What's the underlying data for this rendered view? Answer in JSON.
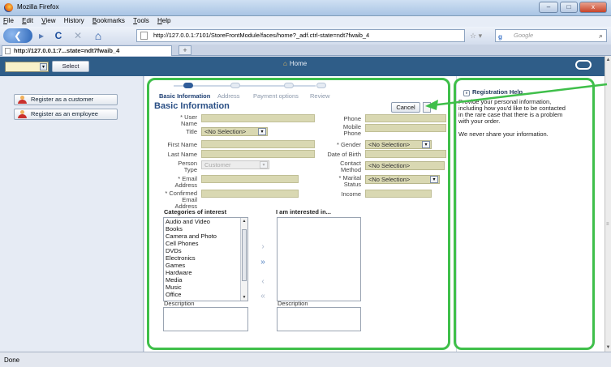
{
  "window": {
    "title": "Mozilla Firefox",
    "minimize_glyph": "–",
    "maximize_glyph": "□",
    "close_glyph": "x"
  },
  "menu": {
    "items": [
      {
        "label": "File",
        "key": "F",
        "rest": "ile"
      },
      {
        "label": "Edit",
        "key": "E",
        "rest": "dit"
      },
      {
        "label": "View",
        "key": "V",
        "rest": "iew"
      },
      {
        "label": "History",
        "key": "",
        "rest": "History"
      },
      {
        "label": "Bookmarks",
        "key": "B",
        "rest": "ookmarks"
      },
      {
        "label": "Tools",
        "key": "T",
        "rest": "ools"
      },
      {
        "label": "Help",
        "key": "H",
        "rest": "elp"
      }
    ]
  },
  "navbar": {
    "back_glyph": "❮",
    "forward_glyph": "▸",
    "reload_glyph": "C",
    "stop_glyph": "✕",
    "home_glyph": "⌂",
    "url": "http://127.0.0.1:7101/StoreFrontModule/faces/home?_adf.ctrl-state=ndt7fwaib_4",
    "star_glyph": "☆ ▾",
    "search_engine": "g",
    "search_placeholder": "Google",
    "search_glyph": "⌕"
  },
  "tabs": {
    "active_tab": "http://127.0.0.1:7...state=ndt7fwaib_4",
    "new_tab_glyph": "+"
  },
  "appbar": {
    "select_button": "Select",
    "home_label": "Home",
    "home_glyph": "⌂"
  },
  "left_panel": {
    "register_customer": "Register as a customer",
    "register_employee": "Register as an employee"
  },
  "train": {
    "steps": [
      "Basic Information",
      "Address",
      "Payment options",
      "Review"
    ],
    "active_index": 0
  },
  "form": {
    "title": "Basic Information",
    "cancel": "Cancel",
    "labels": {
      "user_name": [
        "* User",
        "Name"
      ],
      "title": "Title",
      "first_name": "First Name",
      "last_name": "Last Name",
      "person_type": [
        "Person",
        "Type"
      ],
      "email": [
        "* Email",
        "Address"
      ],
      "confirmed_email": [
        "* Confirmed",
        "Email",
        "Address"
      ],
      "phone": "Phone",
      "mobile_phone": [
        "Mobile",
        "Phone"
      ],
      "gender": "* Gender",
      "date_of_birth": "Date of Birth",
      "contact_method": [
        "Contact",
        "Method"
      ],
      "marital_status": [
        "* Marital",
        "Status"
      ],
      "income": "Income"
    },
    "values": {
      "title": "<No Selection>",
      "person_type": "Customer",
      "gender": "<No Selection>",
      "contact_method": "<No Selection>",
      "marital_status": "<No Selection>"
    },
    "dropdown_glyph": "▾",
    "categories_header": "Categories of interest",
    "interested_header": "I am interested in...",
    "categories": [
      "Audio and Video",
      "Books",
      "Camera and Photo",
      "Cell Phones",
      "DVDs",
      "Electronics",
      "Games",
      "Hardware",
      "Media",
      "Music",
      "Office"
    ],
    "interested": [],
    "description_label": "Description",
    "description_label_right": "Description",
    "move_glyphs": {
      "move": "›",
      "move_all": "»",
      "remove": "‹",
      "remove_all": "«"
    }
  },
  "help_panel": {
    "header": "Registration Help",
    "lines": [
      "Provide your personal information,",
      "including how you'd like to be contacted",
      "in the rare case that there is a problem",
      "with your order."
    ],
    "note": "We never share your information.",
    "collapse_glyph": "∨"
  },
  "status": {
    "text": "Done"
  },
  "colors": {
    "highlight_green": "#3fbf4a",
    "appbar_blue": "#2f5d88",
    "field_fill": "#d9d8b2"
  }
}
